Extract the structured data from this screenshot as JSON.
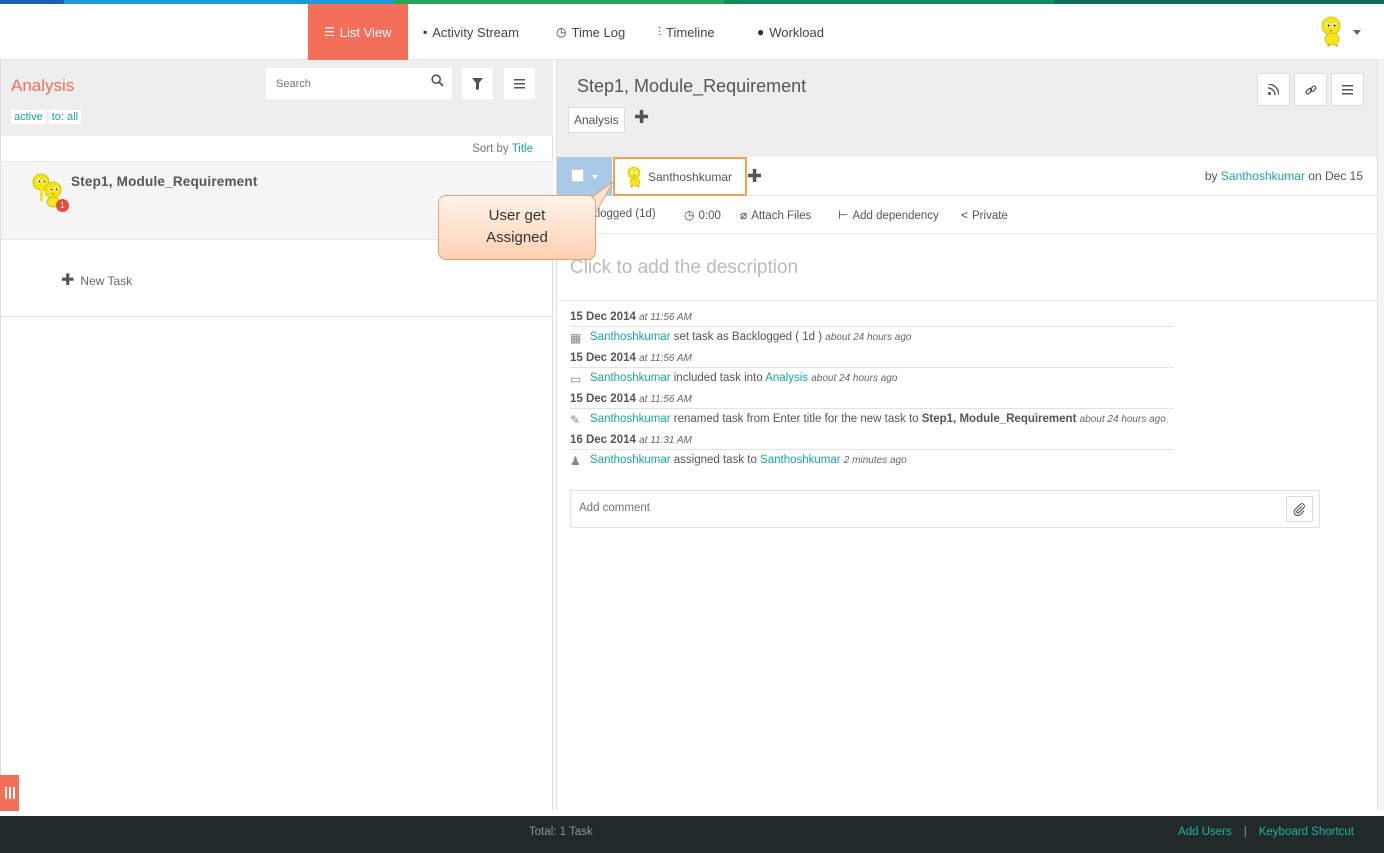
{
  "strip_colors": [
    "#1a5fb4",
    "#1e9bd7",
    "#27a65b",
    "#138a5f",
    "#0f6e5a"
  ],
  "nav": {
    "tabs": [
      {
        "label": "List View",
        "icon": "list-icon",
        "glyph": "☰",
        "active": true
      },
      {
        "label": "Activity Stream",
        "icon": "comment-icon",
        "glyph": "▪",
        "active": false
      },
      {
        "label": "Time Log",
        "icon": "clock-icon",
        "glyph": "◷",
        "active": false
      },
      {
        "label": "Timeline",
        "icon": "timeline-icon",
        "glyph": "⫶",
        "active": false
      },
      {
        "label": "Workload",
        "icon": "user-icon",
        "glyph": "●",
        "active": false
      }
    ]
  },
  "left": {
    "project_title": "Analysis",
    "filter_active": "active",
    "filter_to": "to: all",
    "search_placeholder": "Search",
    "sort_prefix": "Sort by",
    "sort_field": "Title",
    "task_title": "Step1, Module_Requirement",
    "task_badge": "1",
    "new_task_label": "New Task"
  },
  "right": {
    "title": "Step1, Module_Requirement",
    "project_chip": "Analysis",
    "assignee": "Santhoshkumar",
    "by_prefix": "by",
    "by_user": "Santhoshkumar",
    "by_suffix": "on Dec 15",
    "meta": {
      "status": "Backlogged (1d)",
      "time": "0:00",
      "attach": "Attach Files",
      "dependency": "Add dependency",
      "privacy": "Private"
    },
    "description_placeholder": "Click to add the description",
    "activity": [
      {
        "date": "15 Dec 2014",
        "time": "at 11:56 AM",
        "icon": "calendar-icon",
        "glyph": "▦",
        "user": "Santhoshkumar",
        "text": "set task as Backlogged ( 1d )",
        "ago": "about 24 hours ago"
      },
      {
        "date": "15 Dec 2014",
        "time": "at 11:56 AM",
        "icon": "folder-icon",
        "glyph": "▭",
        "user": "Santhoshkumar",
        "text": "included task into",
        "link": "Analysis",
        "ago": "about 24 hours ago"
      },
      {
        "date": "15 Dec 2014",
        "time": "at 11:56 AM",
        "icon": "pencil-icon",
        "glyph": "✎",
        "user": "Santhoshkumar",
        "text": "renamed task from Enter title for the new task to",
        "bold": "Step1, Module_Requirement",
        "ago": "about 24 hours ago"
      },
      {
        "date": "16 Dec 2014",
        "time": "at 11:31 AM",
        "icon": "user-assign-icon",
        "glyph": "♟",
        "user": "Santhoshkumar",
        "text": "assigned task to",
        "link": "Santhoshkumar",
        "ago": "2 minutes ago"
      }
    ],
    "comment_placeholder": "Add comment"
  },
  "callout": {
    "line1": "User get",
    "line2": "Assigned"
  },
  "footer": {
    "total": "Total: 1 Task",
    "add_users": "Add Users",
    "separator": "|",
    "shortcut": "Keyboard Shortcut"
  }
}
